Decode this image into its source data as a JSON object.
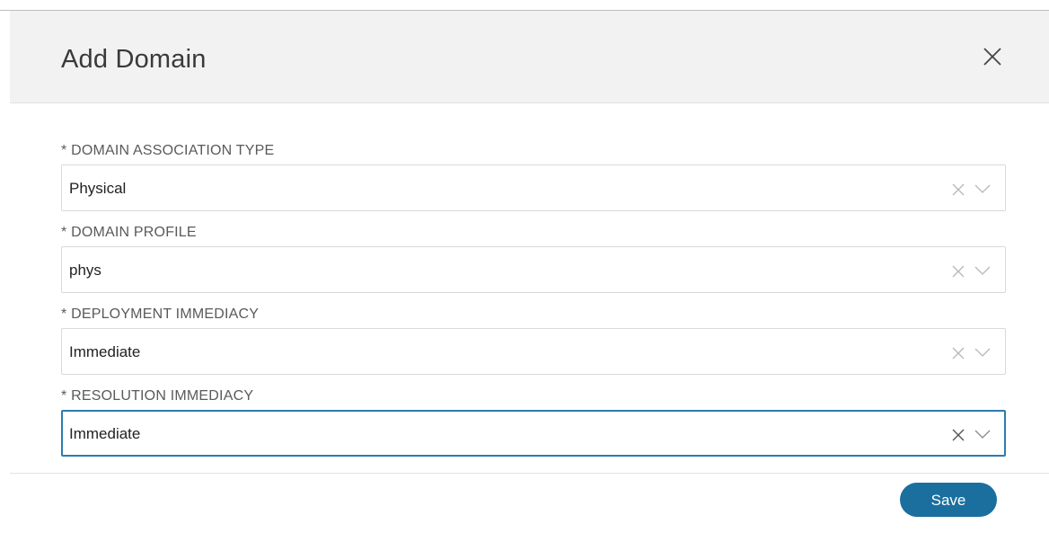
{
  "dialog": {
    "title": "Add Domain",
    "close_icon": "close-icon"
  },
  "fields": [
    {
      "label": "* DOMAIN ASSOCIATION TYPE",
      "value": "Physical"
    },
    {
      "label": "* DOMAIN PROFILE",
      "value": "phys"
    },
    {
      "label": "* DEPLOYMENT IMMEDIACY",
      "value": "Immediate"
    },
    {
      "label": "* RESOLUTION IMMEDIACY",
      "value": "Immediate"
    }
  ],
  "footer": {
    "save_label": "Save"
  },
  "colors": {
    "primary": "#1a6f9e",
    "focus_border": "#2c7cb0",
    "header_bg": "#f2f2f2"
  }
}
